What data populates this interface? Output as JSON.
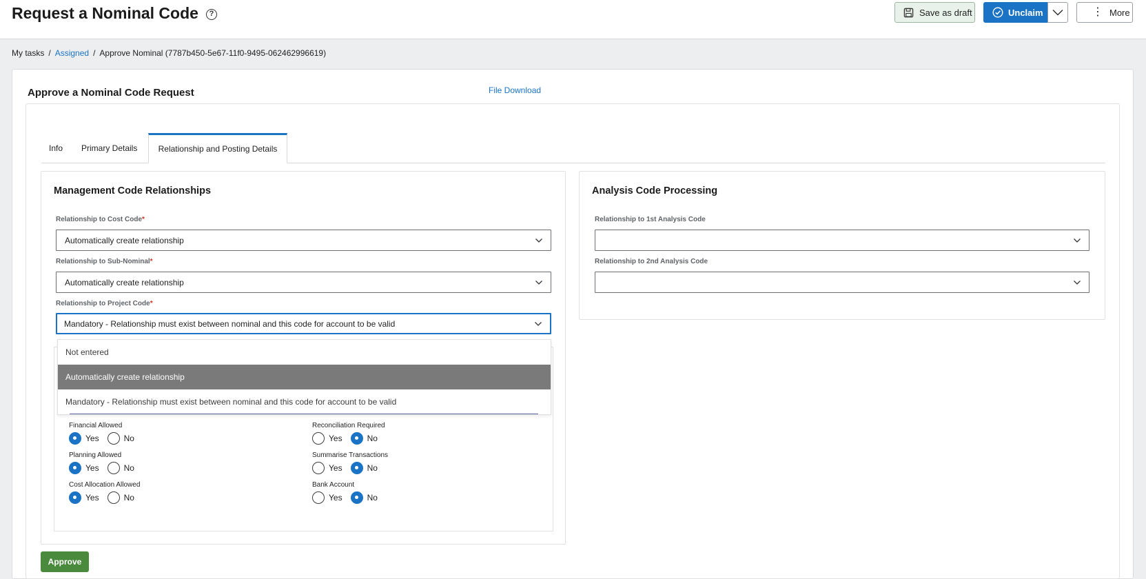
{
  "header": {
    "title": "Request a Nominal Code",
    "help_icon": "?",
    "save_draft_label": "Save as draft",
    "unclaim_label": "Unclaim",
    "more_label": "More"
  },
  "breadcrumb": {
    "items": [
      "My tasks",
      "Assigned",
      "Approve Nominal (7787b450-5e67-11f0-9495-062462996619)"
    ],
    "separator": "/"
  },
  "form": {
    "title": "Approve a Nominal Code Request",
    "file_download": "File Download"
  },
  "tabs": [
    {
      "label": "Info",
      "active": false
    },
    {
      "label": "Primary Details",
      "active": false
    },
    {
      "label": "Relationship and Posting Details",
      "active": true
    }
  ],
  "management": {
    "title": "Management Code Relationships",
    "cost_code": {
      "label": "Relationship to Cost Code",
      "required": "*",
      "value": "Automatically create relationship"
    },
    "sub_nominal": {
      "label": "Relationship to Sub-Nominal",
      "required": "*",
      "value": "Automatically create relationship"
    },
    "project_code": {
      "label": "Relationship to Project Code",
      "required": "*",
      "value": "Mandatory - Relationship must exist between nominal and this code for account to be valid"
    }
  },
  "dropdown": {
    "options": [
      "Not entered",
      "Automatically create relationship",
      "Mandatory - Relationship must exist between nominal and this code for account to be valid"
    ],
    "highlighted_index": 1
  },
  "analysis": {
    "title": "Analysis Code Processing",
    "first": {
      "label": "Relationship to 1st Analysis Code",
      "value": ""
    },
    "second": {
      "label": "Relationship to 2nd Analysis Code",
      "value": ""
    }
  },
  "options": {
    "yes_label": "Yes",
    "no_label": "No",
    "financial_allowed": {
      "label": "Financial Allowed",
      "selected": "Yes"
    },
    "planning_allowed": {
      "label": "Planning Allowed",
      "selected": "Yes"
    },
    "cost_allocation_allowed": {
      "label": "Cost Allocation Allowed",
      "selected": "Yes"
    },
    "reconciliation_required": {
      "label": "Reconciliation Required",
      "selected": "No"
    },
    "summarise_transactions": {
      "label": "Summarise Transactions",
      "selected": "No"
    },
    "bank_account": {
      "label": "Bank Account",
      "selected": "No"
    }
  },
  "actions": {
    "approve_label": "Approve"
  },
  "colors": {
    "accent": "#1a73c4",
    "approve": "#4a8a3d",
    "highlight": "#7a7a7a"
  }
}
